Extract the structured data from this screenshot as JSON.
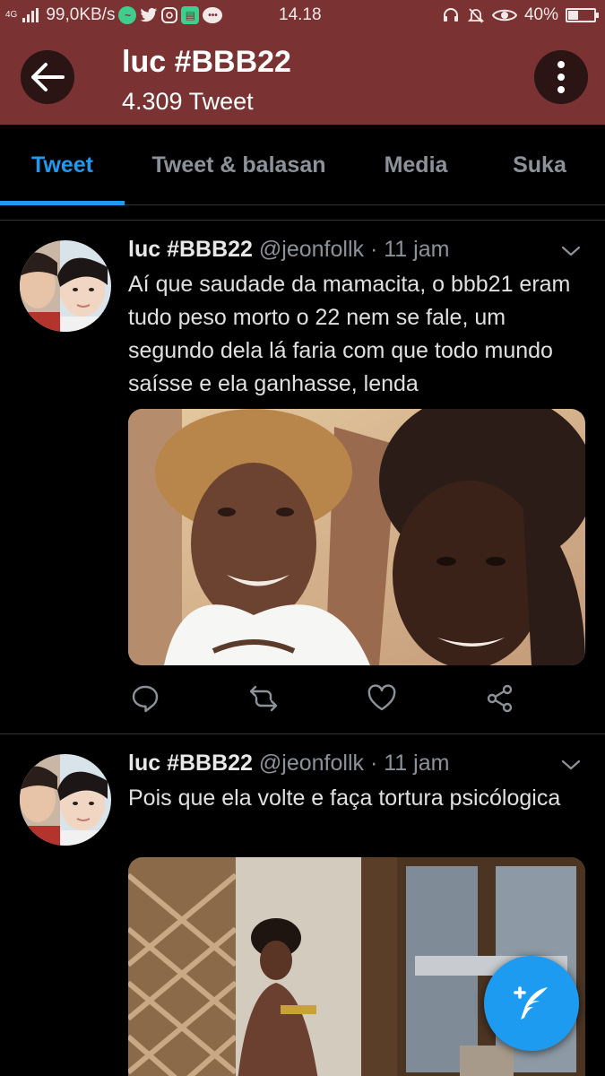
{
  "status_bar": {
    "network_type": "4G",
    "speed": "99,0KB/s",
    "time": "14.18",
    "battery_percent": "40%",
    "battery_level": 0.4,
    "icons": [
      "signal-icon",
      "messenger-icon",
      "twitter-icon",
      "instagram-icon",
      "line-icon",
      "chat-icon",
      "headset-icon",
      "mute-icon",
      "eye-icon",
      "battery-icon"
    ]
  },
  "header": {
    "title": "luc #BBB22",
    "subtitle": "4.309 Tweet",
    "background": "#7a3232"
  },
  "tabs": [
    {
      "label": "Tweet",
      "active": true
    },
    {
      "label": "Tweet & balasan",
      "active": false
    },
    {
      "label": "Media",
      "active": false
    },
    {
      "label": "Suka",
      "active": false
    }
  ],
  "accent_color": "#1d9bf0",
  "tweets": [
    {
      "name": "luc #BBB22",
      "handle": "@jeonfollk",
      "separator": "·",
      "time": "11 jam",
      "text": "Aí que saudade da mamacita, o bbb21 eram tudo peso morto o 22 nem se fale, um segundo dela lá faria com que todo mundo saísse e ela ganhasse, lenda"
    },
    {
      "name": "luc #BBB22",
      "handle": "@jeonfollk",
      "separator": "·",
      "time": "11 jam",
      "text": "Pois que ela volte e faça tortura psicólogica"
    }
  ]
}
